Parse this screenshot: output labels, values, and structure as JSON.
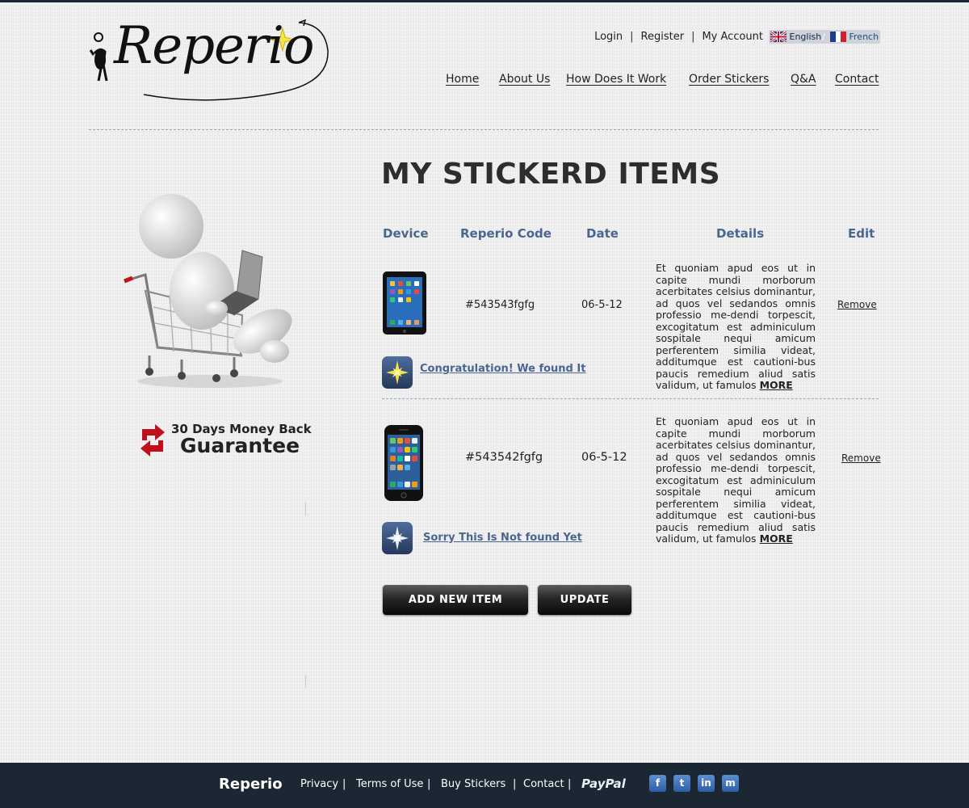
{
  "header": {
    "logo_text": "Reperio",
    "top_links": [
      "Login",
      "Register",
      "My Account"
    ],
    "languages": [
      {
        "label": "English",
        "icon": "uk-flag-icon"
      },
      {
        "label": "French",
        "icon": "france-flag-icon"
      }
    ],
    "lang_separator": "/"
  },
  "nav": {
    "items": [
      "Home",
      "About Us",
      "How Does It Work",
      "Order Stickers",
      "Q&A",
      "Contact"
    ]
  },
  "sidebar": {
    "guarantee_line1": "30 Days Money Back",
    "guarantee_line2": "Guarantee"
  },
  "main": {
    "title": "MY STICKERD ITEMS",
    "columns": [
      "Device",
      "Reperio Code",
      "Date",
      "Details",
      "Edit"
    ],
    "rows": [
      {
        "device": "ipad-mini",
        "code": "#543543fgfg",
        "date": "06-5-12",
        "details": "Et quoniam apud eos ut in capite mundi morborum acerbitates celsius dominantur, ad quos vel sedandos omnis professio me-dendi torpescit, excogitatum est adminiculum sospitale nequi amicum perferentem similia videat, additumque est cautioni-bus paucis remedium aliud satis validum, ut famulos",
        "more": "MORE",
        "edit": "Remove",
        "status": "Congratulation! We found It",
        "status_icon": "star-found-icon"
      },
      {
        "device": "iphone",
        "code": "#543542fgfg",
        "date": "06-5-12",
        "details": "Et quoniam apud eos ut in capite mundi morborum acerbitates celsius dominantur, ad quos vel sedandos omnis professio me-dendi torpescit, excogitatum est adminiculum sospitale nequi amicum perferentem similia videat, additumque est cautioni-bus paucis remedium aliud satis validum, ut famulos",
        "more": "MORE",
        "edit": "Remove",
        "status": "Sorry This Is Not found Yet",
        "status_icon": "star-notfound-icon"
      }
    ],
    "buttons": {
      "add": "ADD NEW ITEM",
      "update": "UPDATE"
    }
  },
  "footer": {
    "brand": "Reperio",
    "links": [
      "Privacy",
      "Terms of Use",
      "Buy Stickers",
      "Contact"
    ],
    "separator": "|",
    "paypal": "PayPal",
    "social": [
      "facebook-icon",
      "twitter-icon",
      "linkedin-icon",
      "myspace-icon"
    ]
  },
  "colors": {
    "background": "#ededed",
    "footer": "#1b2732",
    "heading_blue": "#4a6690",
    "button_dark": "#1a1a1a",
    "star_yellow": "#f3e44a"
  }
}
